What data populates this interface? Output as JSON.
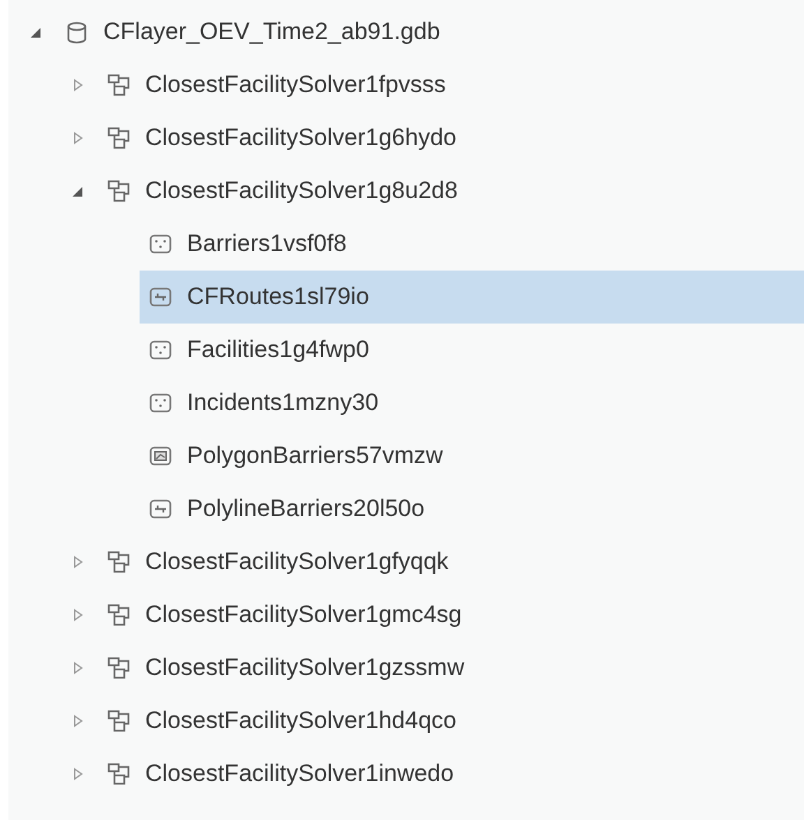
{
  "tree": [
    {
      "label": "CFlayer_OEV_Time2_ab91.gdb",
      "kind": "database",
      "expanded": true,
      "selected": false,
      "children": [
        {
          "label": "ClosestFacilitySolver1fpvsss",
          "kind": "dataset",
          "expanded": false,
          "selected": false
        },
        {
          "label": "ClosestFacilitySolver1g6hydo",
          "kind": "dataset",
          "expanded": false,
          "selected": false
        },
        {
          "label": "ClosestFacilitySolver1g8u2d8",
          "kind": "dataset",
          "expanded": true,
          "selected": false,
          "children": [
            {
              "label": "Barriers1vsf0f8",
              "kind": "point",
              "selected": false
            },
            {
              "label": "CFRoutes1sl79io",
              "kind": "line",
              "selected": true
            },
            {
              "label": "Facilities1g4fwp0",
              "kind": "point",
              "selected": false
            },
            {
              "label": "Incidents1mzny30",
              "kind": "point",
              "selected": false
            },
            {
              "label": "PolygonBarriers57vmzw",
              "kind": "polygon",
              "selected": false
            },
            {
              "label": "PolylineBarriers20l50o",
              "kind": "line",
              "selected": false
            }
          ]
        },
        {
          "label": "ClosestFacilitySolver1gfyqqk",
          "kind": "dataset",
          "expanded": false,
          "selected": false
        },
        {
          "label": "ClosestFacilitySolver1gmc4sg",
          "kind": "dataset",
          "expanded": false,
          "selected": false
        },
        {
          "label": "ClosestFacilitySolver1gzssmw",
          "kind": "dataset",
          "expanded": false,
          "selected": false
        },
        {
          "label": "ClosestFacilitySolver1hd4qco",
          "kind": "dataset",
          "expanded": false,
          "selected": false
        },
        {
          "label": "ClosestFacilitySolver1inwedo",
          "kind": "dataset",
          "expanded": false,
          "selected": false
        }
      ]
    }
  ]
}
